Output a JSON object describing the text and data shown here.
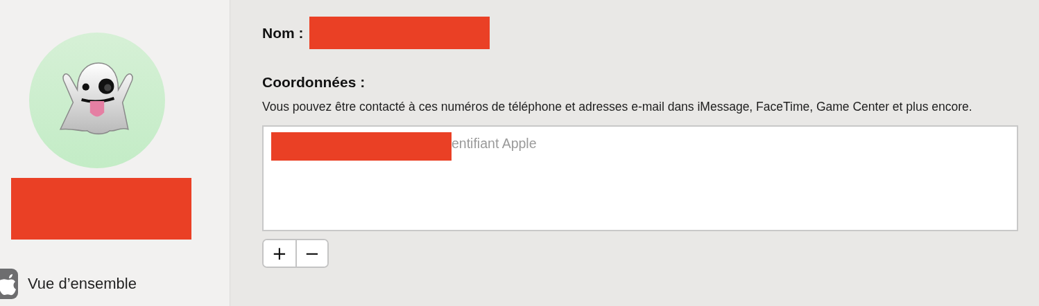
{
  "sidebar": {
    "items": [
      {
        "label": "Vue d’ensemble",
        "selected": false
      }
    ]
  },
  "main": {
    "name_label": "Nom :",
    "contact_heading": "Coordonnées :",
    "contact_description": "Vous pouvez être contacté à ces numéros de téléphone et adresses e-mail dans iMessage, FaceTime, Game Center et plus encore.",
    "contacts": [
      {
        "label": "entifiant Apple"
      }
    ],
    "list_buttons": [
      "+",
      "−"
    ]
  }
}
